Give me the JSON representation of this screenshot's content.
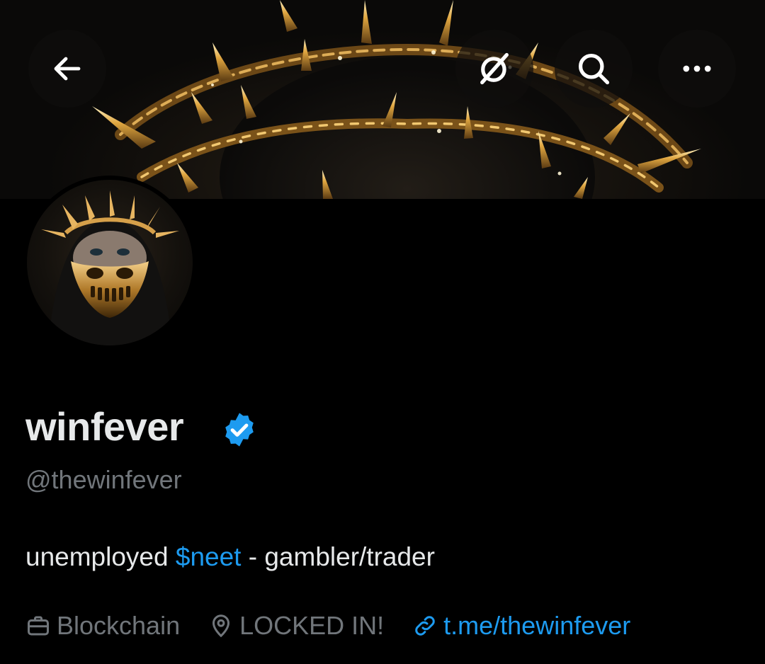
{
  "header": {
    "back_icon": "arrow-left-icon",
    "grok_icon": "grok-icon",
    "search_icon": "search-icon",
    "more_icon": "more-dots-icon"
  },
  "profile": {
    "display_name": "winfever",
    "verified": true,
    "handle": "@thewinfever",
    "bio_before": "unemployed ",
    "bio_cashtag": "$neet",
    "bio_after": " - gambler/trader",
    "category": "Blockchain",
    "location": "LOCKED IN!",
    "link": "t.me/thewinfever"
  },
  "colors": {
    "background": "#000000",
    "text_primary": "#e7e9ea",
    "text_secondary": "#71767b",
    "accent": "#1d9bf0"
  }
}
